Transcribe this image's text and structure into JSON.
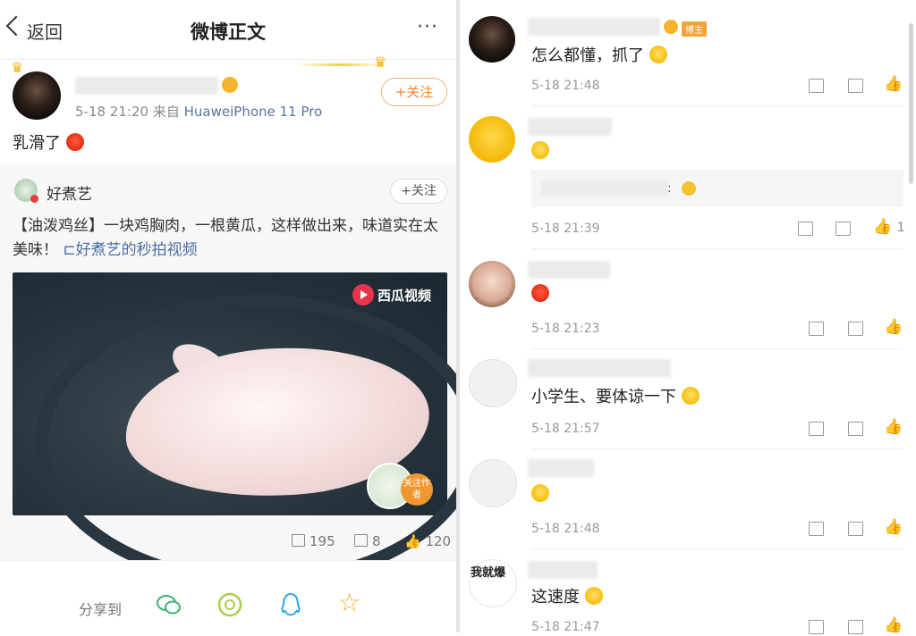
{
  "header": {
    "back_label": "返回",
    "title": "微博正文",
    "more": "···"
  },
  "post": {
    "time": "5-18 21:20",
    "source_prefix": "来自",
    "source": "HuaweiPhone 11 Pro",
    "follow_label": "+关注",
    "text": "乳滑了"
  },
  "repost": {
    "author": "好煮艺",
    "follow_label": "+关注",
    "text": "【油泼鸡丝】一块鸡胸肉，一根黄瓜，这样做出来，味道实在太美味！",
    "video_link": "好煮艺的秒拍视频",
    "video_watermark": "西瓜视频",
    "author_follow": "关注作者",
    "stats": {
      "reposts": "195",
      "comments": "8",
      "likes": "120"
    }
  },
  "share": {
    "label": "分享到",
    "icons": [
      "wechat-icon",
      "moments-icon",
      "qq-icon",
      "star-icon"
    ]
  },
  "comments": [
    {
      "text": "怎么都懂，抓了",
      "time": "5-18 21:48",
      "likes": "",
      "badge": "博主"
    },
    {
      "text": "",
      "time": "5-18 21:39",
      "likes": "1"
    },
    {
      "text": "",
      "time": "5-18 21:23",
      "likes": ""
    },
    {
      "text": "小学生、要体谅一下",
      "time": "5-18 21:57",
      "likes": ""
    },
    {
      "text": "",
      "time": "5-18 21:48",
      "likes": ""
    },
    {
      "text": "这速度",
      "time": "5-18 21:47",
      "likes": "",
      "avatar_text": "我就爆"
    }
  ],
  "colors": {
    "accent_orange": "#ee8531",
    "link_blue": "#4a6fa5"
  }
}
